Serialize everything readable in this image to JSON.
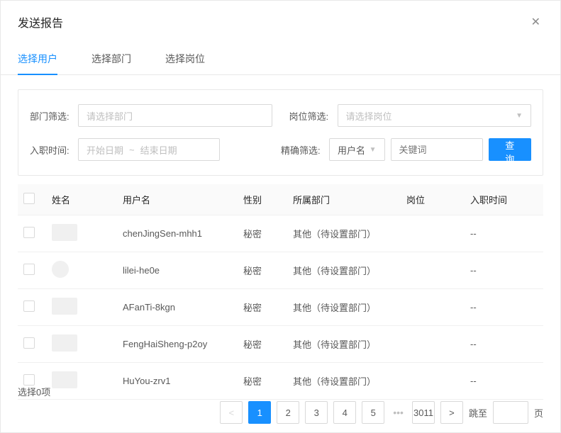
{
  "modal": {
    "title": "发送报告"
  },
  "tabs": [
    {
      "label": "选择用户",
      "active": true
    },
    {
      "label": "选择部门",
      "active": false
    },
    {
      "label": "选择岗位",
      "active": false
    }
  ],
  "filters": {
    "dept_label": "部门筛选:",
    "dept_placeholder": "请选择部门",
    "post_label": "岗位筛选:",
    "post_placeholder": "请选择岗位",
    "hire_label": "入职时间:",
    "date_start_placeholder": "开始日期",
    "date_end_placeholder": "结束日期",
    "precise_label": "精确筛选:",
    "precise_field": "用户名",
    "keyword_placeholder": "关键词",
    "search_btn": "查 询"
  },
  "table": {
    "headers": {
      "name": "姓名",
      "username": "用户名",
      "gender": "性别",
      "dept": "所属部门",
      "post": "岗位",
      "hire": "入职时间"
    },
    "rows": [
      {
        "username": "chenJingSen-mhh1",
        "gender": "秘密",
        "dept": "其他（待设置部门）",
        "post": "",
        "hire": "--"
      },
      {
        "username": "lilei-he0e",
        "gender": "秘密",
        "dept": "其他（待设置部门）",
        "post": "",
        "hire": "--"
      },
      {
        "username": "AFanTi-8kgn",
        "gender": "秘密",
        "dept": "其他（待设置部门）",
        "post": "",
        "hire": "--"
      },
      {
        "username": "FengHaiSheng-p2oy",
        "gender": "秘密",
        "dept": "其他（待设置部门）",
        "post": "",
        "hire": "--"
      },
      {
        "username": "HuYou-zrv1",
        "gender": "秘密",
        "dept": "其他（待设置部门）",
        "post": "",
        "hire": "--"
      }
    ]
  },
  "selection": {
    "text": "选择0项"
  },
  "pagination": {
    "pages": [
      "1",
      "2",
      "3",
      "4",
      "5"
    ],
    "last": "3011",
    "jump_prefix": "跳至",
    "jump_suffix": "页"
  }
}
